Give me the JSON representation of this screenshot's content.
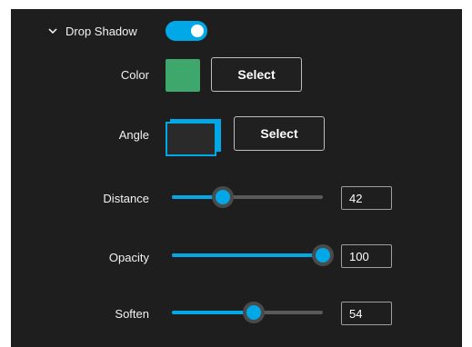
{
  "drop_shadow": {
    "title": "Drop Shadow",
    "enabled": true,
    "expanded_icon": "chevron-down-icon"
  },
  "color": {
    "label": "Color",
    "swatch": "#3ea76b",
    "select_label": "Select"
  },
  "angle": {
    "label": "Angle",
    "select_label": "Select",
    "preview_icon": "shadow-angle-preview-icon"
  },
  "sliders": {
    "distance": {
      "label": "Distance",
      "value": "42",
      "level": 0.34
    },
    "opacity": {
      "label": "Opacity",
      "value": "100",
      "level": 1.0
    },
    "soften": {
      "label": "Soften",
      "value": "54",
      "level": 0.54
    }
  },
  "colors": {
    "accent": "#00a8e8",
    "background": "#1e1e1e"
  }
}
